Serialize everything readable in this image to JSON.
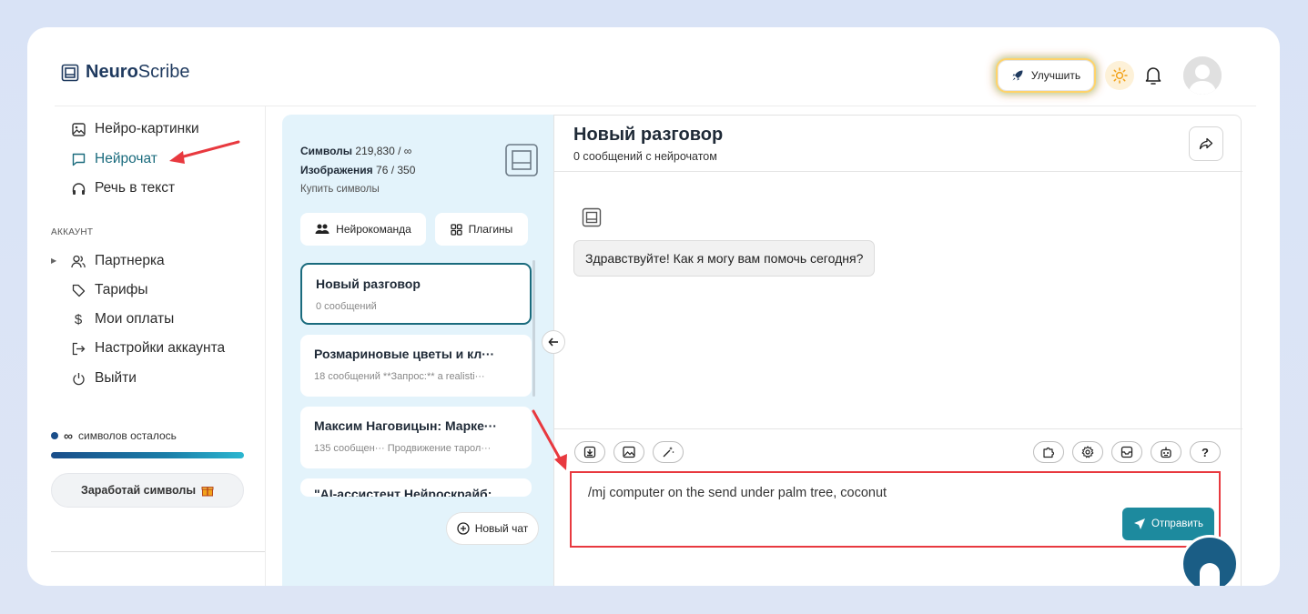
{
  "header": {
    "logo_bold": "Neuro",
    "logo_rest": "Scribe",
    "upgrade_label": "Улучшить"
  },
  "sidebar": {
    "items": [
      {
        "label": "Нейро-картинки",
        "icon": "image-icon"
      },
      {
        "label": "Нейрочат",
        "icon": "chat-icon"
      },
      {
        "label": "Речь в текст",
        "icon": "headphones-icon"
      }
    ],
    "account_label": "АККАУНТ",
    "account_items": [
      {
        "label": "Партнерка",
        "icon": "users-icon"
      },
      {
        "label": "Тарифы",
        "icon": "tag-icon"
      },
      {
        "label": "Мои оплаты",
        "icon": "dollar-icon"
      },
      {
        "label": "Настройки аккаунта",
        "icon": "login-icon"
      },
      {
        "label": "Выйти",
        "icon": "power-icon"
      }
    ],
    "credits_text": "∞",
    "credits_suffix": "символов осталось",
    "earn_label": "Заработай символы"
  },
  "list_panel": {
    "symbols_label": "Символы",
    "symbols_value": "219,830 / ∞",
    "images_label": "Изображения",
    "images_value": "76 / 350",
    "buy_label": "Купить символы",
    "team_label": "Нейрокоманда",
    "plugins_label": "Плагины",
    "chats": [
      {
        "title": "Новый разговор",
        "sub": "0 сообщений"
      },
      {
        "title": "Розмариновые цветы и кл···",
        "sub": "18 сообщений  **Запрос:** a realisti···"
      },
      {
        "title": "Максим Наговицын: Марке···",
        "sub": "135 сообщен··· Продвижение тарол···"
      },
      {
        "title": "\"AI-ассистент Нейроскрайб:",
        "sub": ""
      }
    ],
    "new_chat_label": "Новый чат"
  },
  "chat": {
    "title": "Новый разговор",
    "subtitle": "0 сообщений с нейрочатом",
    "greeting": "Здравствуйте! Как я могу вам помочь сегодня?",
    "input_value": "/mj computer on the send under palm tree, coconut",
    "send_label": "Отправить",
    "help_label": "?"
  },
  "colors": {
    "accent": "#1d8a9e",
    "annotation": "#e8393f",
    "panel_bg": "#e3f3fb"
  }
}
